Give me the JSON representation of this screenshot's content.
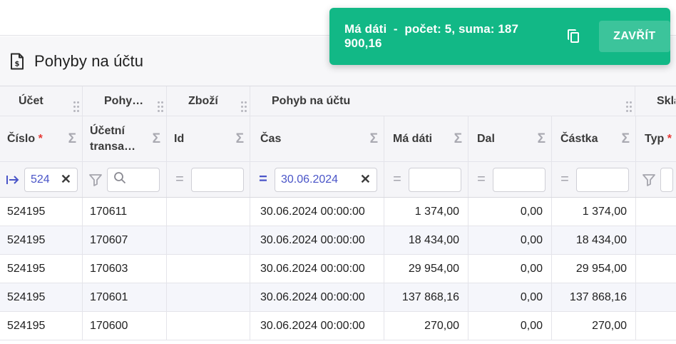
{
  "page": {
    "title": "Pohyby na účtu"
  },
  "toast": {
    "label": "Má dáti",
    "separator": "-",
    "count_text": "počet: 5,",
    "sum_text": "suma: 187 900,16",
    "close_label": "ZAVŘÍT",
    "color": "#12b886"
  },
  "grid": {
    "groups": [
      "Účet",
      "Pohy…",
      "Zboží",
      "Pohyb na účtu",
      "Skla"
    ],
    "columns": [
      {
        "label": "Číslo",
        "required": "*"
      },
      {
        "label_line1": "Účetní",
        "label_line2": "transa…"
      },
      {
        "label": "Id"
      },
      {
        "label": "Čas"
      },
      {
        "label": "Má dáti"
      },
      {
        "label": "Dal"
      },
      {
        "label": "Částka"
      },
      {
        "label": "Typ",
        "required": "*"
      }
    ],
    "sigma": "Σ",
    "filters": {
      "cislo_value": "524",
      "cas_value": "30.06.2024",
      "clear": "✕",
      "equals": "="
    },
    "rows": [
      {
        "cislo": "524195",
        "transakce": "170611",
        "id": "",
        "cas": "30.06.2024 00:00:00",
        "ma_dati": "1 374,00",
        "dal": "0,00",
        "castka": "1 374,00"
      },
      {
        "cislo": "524195",
        "transakce": "170607",
        "id": "",
        "cas": "30.06.2024 00:00:00",
        "ma_dati": "18 434,00",
        "dal": "0,00",
        "castka": "18 434,00"
      },
      {
        "cislo": "524195",
        "transakce": "170603",
        "id": "",
        "cas": "30.06.2024 00:00:00",
        "ma_dati": "29 954,00",
        "dal": "0,00",
        "castka": "29 954,00"
      },
      {
        "cislo": "524195",
        "transakce": "170601",
        "id": "",
        "cas": "30.06.2024 00:00:00",
        "ma_dati": "137 868,16",
        "dal": "0,00",
        "castka": "137 868,16"
      },
      {
        "cislo": "524195",
        "transakce": "170600",
        "id": "",
        "cas": "30.06.2024 00:00:00",
        "ma_dati": "270,00",
        "dal": "0,00",
        "castka": "270,00"
      }
    ]
  },
  "colors": {
    "accent": "#4a55c8",
    "required": "#e53935",
    "toast": "#12b886"
  },
  "icons": [
    "document-icon",
    "filter-icon",
    "search-icon",
    "arrow-right-bar-icon",
    "copy-icon",
    "sigma-icon",
    "drag-grip-icon"
  ]
}
